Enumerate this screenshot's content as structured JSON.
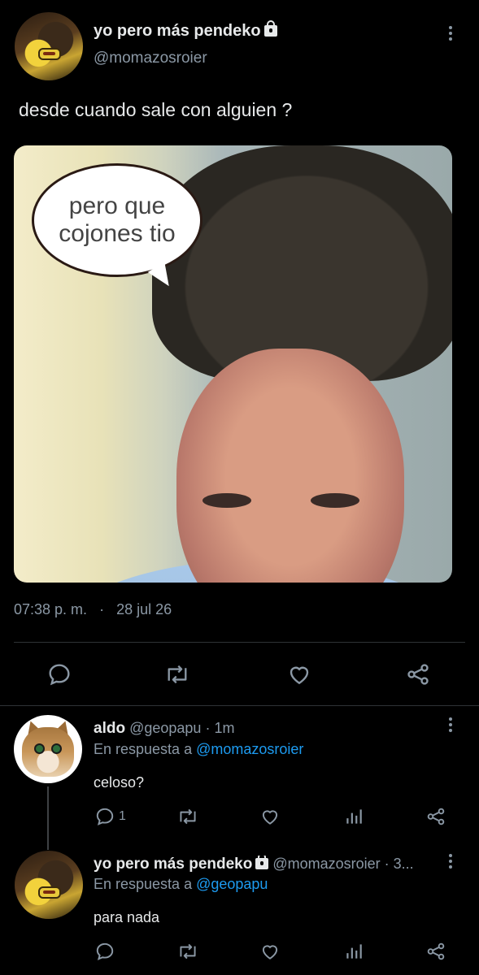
{
  "main_tweet": {
    "author_name": "yo pero más pendeko",
    "author_handle": "@momazosroier",
    "text": "desde cuando sale con alguien ?",
    "image_caption": [
      "pero que",
      "cojones tio"
    ],
    "time": "07:38 p. m.",
    "separator": "·",
    "date": "28 jul 26",
    "actions": [
      "reply-icon",
      "retweet-icon",
      "like-icon",
      "share-icon"
    ]
  },
  "replies": [
    {
      "author_name": "aldo",
      "author_handle": "@geopapu",
      "time": "· 1m",
      "reply_prefix": "En respuesta a ",
      "reply_to": "@momazosroier",
      "text": "celoso?",
      "reply_count": "1",
      "actions": [
        "reply-icon",
        "retweet-icon",
        "like-icon",
        "views-icon",
        "share-icon"
      ]
    },
    {
      "author_name": "yo pero más pendeko",
      "author_handle": "@momazosroier · 3...",
      "reply_prefix": "En respuesta a ",
      "reply_to": "@geopapu",
      "text": "para nada",
      "actions": [
        "reply-icon",
        "retweet-icon",
        "like-icon",
        "views-icon",
        "share-icon"
      ]
    }
  ],
  "colors": {
    "background": "#000000",
    "text": "#e7e9ea",
    "muted": "#8b98a5",
    "link": "#1d9bf0"
  }
}
